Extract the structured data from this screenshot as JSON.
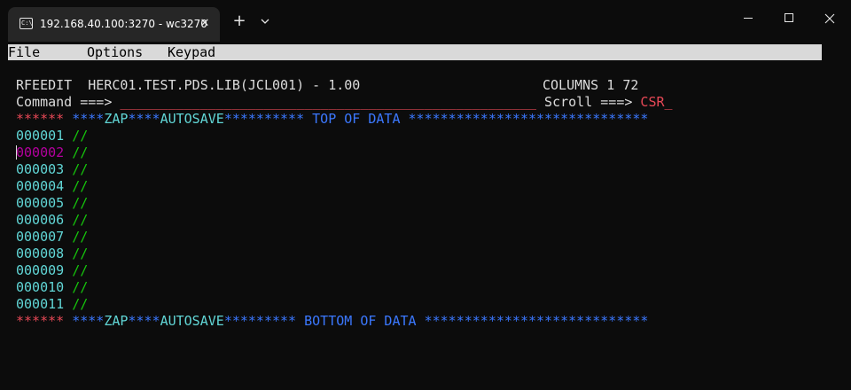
{
  "window": {
    "tab_title": "192.168.40.100:3270 - wc3270",
    "tab_icon_text": "C:\\",
    "close_tab": "✕",
    "new_tab": "+"
  },
  "menu": {
    "file": "File",
    "options": "Options",
    "keypad": "Keypad"
  },
  "editor": {
    "program": "RFEEDIT",
    "dataset": "HERC01.TEST.PDS.LIB(JCL001) - 1.00",
    "columns_label": "COLUMNS",
    "columns_from": "1",
    "columns_to": "72",
    "command_label": "Command ===>",
    "command_value": "____________________________________________________",
    "scroll_label": "Scroll ===>",
    "scroll_value": "CSR_",
    "top_marker": "******",
    "top_text": {
      "p1": "****",
      "p2": "ZAP",
      "p3": "****",
      "p4": "AUTOSAVE",
      "p5": "**********",
      "p6": " TOP OF DATA ",
      "p7": "******************************"
    },
    "bottom_marker": "******",
    "bottom_text": {
      "p1": "****",
      "p2": "ZAP",
      "p3": "****",
      "p4": "AUTOSAVE",
      "p5": "*********",
      "p6": " BOTTOM OF DATA ",
      "p7": "****************************"
    },
    "lines": [
      {
        "num": "000001",
        "text": "//"
      },
      {
        "num": "000002",
        "text": "//"
      },
      {
        "num": "000003",
        "text": "//"
      },
      {
        "num": "000004",
        "text": "//"
      },
      {
        "num": "000005",
        "text": "//"
      },
      {
        "num": "000006",
        "text": "//"
      },
      {
        "num": "000007",
        "text": "//"
      },
      {
        "num": "000008",
        "text": "//"
      },
      {
        "num": "000009",
        "text": "//"
      },
      {
        "num": "000010",
        "text": "//"
      },
      {
        "num": "000011",
        "text": "//"
      }
    ]
  },
  "colors": {
    "background": "#0c0c0c",
    "menubar": "#d9d9d9",
    "red": "#e74856",
    "cyan": "#61d6d6",
    "blue": "#3b78ff",
    "green": "#16c60c",
    "magenta": "#b4009e"
  }
}
